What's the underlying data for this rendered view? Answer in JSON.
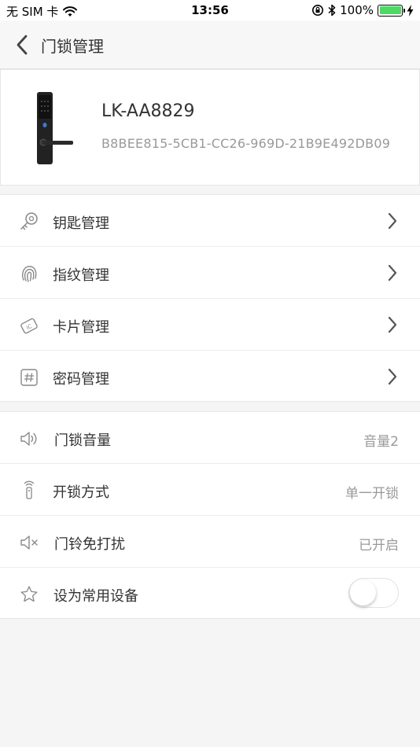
{
  "status_bar": {
    "carrier": "无 SIM 卡",
    "time": "13:56",
    "battery_percent": "100%",
    "battery_level": 1.0,
    "battery_color": "#4cd964",
    "icons": [
      "wifi-icon",
      "rotation-lock-icon",
      "bluetooth-icon",
      "battery-icon",
      "charging-icon"
    ]
  },
  "nav": {
    "title": "门锁管理",
    "back_icon": "chevron-left-icon"
  },
  "device": {
    "name": "LK-AA8829",
    "id": "B8BEE815-5CB1-CC26-969D-21B9E492DB09",
    "image": "door-lock-image"
  },
  "manage_menu": [
    {
      "label": "钥匙管理",
      "icon": "key-icon"
    },
    {
      "label": "指纹管理",
      "icon": "fingerprint-icon"
    },
    {
      "label": "卡片管理",
      "icon": "ic-card-icon"
    },
    {
      "label": "密码管理",
      "icon": "password-icon"
    }
  ],
  "settings": [
    {
      "label": "门锁音量",
      "value": "音量2",
      "icon": "speaker-icon"
    },
    {
      "label": "开锁方式",
      "value": "单一开锁",
      "icon": "remote-icon"
    },
    {
      "label": "门铃免打扰",
      "value": "已开启",
      "icon": "mute-icon"
    },
    {
      "label": "设为常用设备",
      "toggle_on": false,
      "icon": "star-icon"
    }
  ],
  "colors": {
    "background": "#f5f5f5",
    "text_primary": "#333333",
    "text_secondary": "#999999",
    "toggle_off_border": "#e2e2e2"
  }
}
